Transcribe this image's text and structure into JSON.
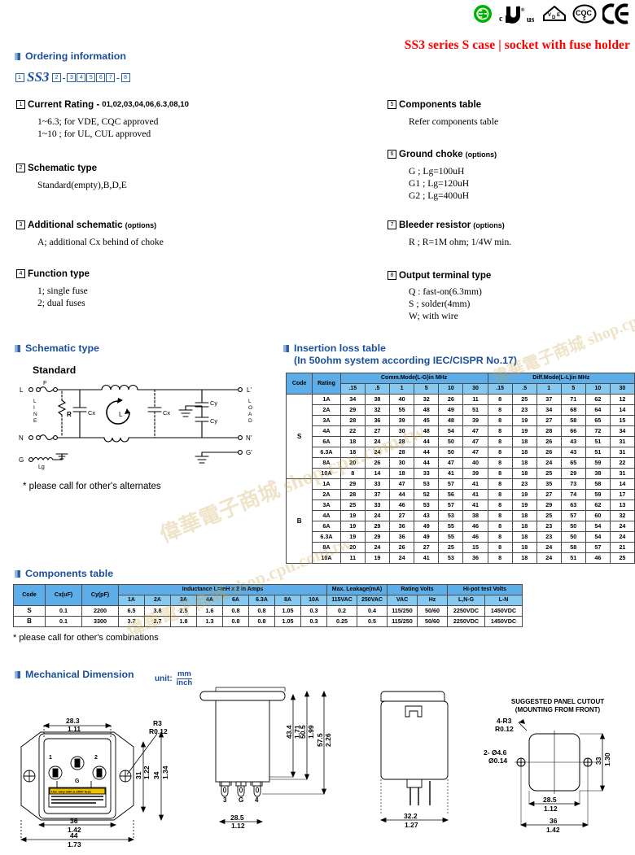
{
  "header": {
    "product_title": "SS3 series S case | socket with fuse holder",
    "certifications": [
      {
        "name": "e-mark-icon",
        "label": "E"
      },
      {
        "name": "ul-recognized-icon",
        "label": "cURus"
      },
      {
        "name": "vde-icon",
        "label": "VDE"
      },
      {
        "name": "cqc-icon",
        "label": "CQC"
      },
      {
        "name": "ce-mark-icon",
        "label": "CE"
      }
    ]
  },
  "ordering": {
    "heading": "Ordering information",
    "code_sequence": [
      "1",
      "SS3",
      "2",
      "-",
      "3",
      "4",
      "5",
      "6",
      "7",
      "-",
      "8"
    ],
    "items": [
      {
        "num": "1",
        "title": "Current Rating -",
        "tail": "01,02,03,04,06,6.3,08,10",
        "option_label": "",
        "lines": [
          "1~6.3; for VDE, CQC approved",
          "1~10 ; for UL, CUL approved"
        ]
      },
      {
        "num": "2",
        "title": "Schematic type",
        "tail": "",
        "option_label": "",
        "lines": [
          "Standard(empty),B,D,E"
        ]
      },
      {
        "num": "3",
        "title": "Additional schematic",
        "tail": "",
        "option_label": "(options)",
        "lines": [
          "A; additional Cx behind of choke"
        ]
      },
      {
        "num": "4",
        "title": "Function type",
        "tail": "",
        "option_label": "",
        "lines": [
          "1; single fuse",
          "2; dual fuses"
        ]
      },
      {
        "num": "5",
        "title": "Components table",
        "tail": "",
        "option_label": "",
        "lines": [
          "Refer components table"
        ]
      },
      {
        "num": "6",
        "title": "Ground choke",
        "tail": "",
        "option_label": "(options)",
        "lines": [
          "G ;  Lg=100uH",
          "G1 ; Lg=120uH",
          "G2 ; Lg=400uH"
        ]
      },
      {
        "num": "7",
        "title": "Bleeder resistor",
        "tail": "",
        "option_label": "(options)",
        "lines": [
          "R ; R=1M ohm; 1/4W min."
        ]
      },
      {
        "num": "8",
        "title": "Output terminal type",
        "tail": "",
        "option_label": "",
        "lines": [
          "Q : fast-on(6.3mm)",
          "S ; solder(4mm)",
          "W; with wire"
        ]
      }
    ]
  },
  "schematic": {
    "heading": "Schematic type",
    "type_label": "Standard",
    "note": "* please call for other's alternates",
    "labels": {
      "in_l": "L",
      "in_n": "N",
      "in_g": "G",
      "out_l": "L'",
      "out_n": "N'",
      "out_g": "G'",
      "line": "LINE",
      "load": "LOAD",
      "fuse": "F",
      "choke": "L",
      "ground_choke": "Lg",
      "resistor": "R",
      "cx": "Cx",
      "cy": "Cy"
    }
  },
  "insertion_loss": {
    "heading_line1": "Insertion loss table",
    "heading_line2": "(In 50ohm system according IEC/CISPR No.17)",
    "col_code": "Code",
    "col_rating": "Rating",
    "group_comm": "Comm.Mode(L-G)in MHz",
    "group_diff": "Diff.Mode(L-L)in MHz",
    "freqs": [
      ".15",
      ".5",
      "1",
      "5",
      "10",
      "30"
    ],
    "groups": [
      {
        "code": "S",
        "rows": [
          {
            "rating": "1A",
            "comm": [
              34,
              38,
              40,
              32,
              26,
              11
            ],
            "diff": [
              8,
              25,
              37,
              71,
              62,
              12
            ]
          },
          {
            "rating": "2A",
            "comm": [
              29,
              32,
              55,
              48,
              49,
              51
            ],
            "diff": [
              8,
              23,
              34,
              68,
              64,
              14
            ]
          },
          {
            "rating": "3A",
            "comm": [
              28,
              36,
              39,
              45,
              48,
              39
            ],
            "diff": [
              8,
              19,
              27,
              58,
              65,
              15
            ]
          },
          {
            "rating": "4A",
            "comm": [
              22,
              27,
              30,
              48,
              54,
              47
            ],
            "diff": [
              8,
              19,
              28,
              66,
              72,
              34
            ]
          },
          {
            "rating": "6A",
            "comm": [
              18,
              24,
              28,
              44,
              50,
              47
            ],
            "diff": [
              8,
              18,
              26,
              43,
              51,
              31
            ]
          },
          {
            "rating": "6.3A",
            "comm": [
              18,
              24,
              28,
              44,
              50,
              47
            ],
            "diff": [
              8,
              18,
              26,
              43,
              51,
              31
            ]
          },
          {
            "rating": "8A",
            "comm": [
              20,
              26,
              30,
              44,
              47,
              40
            ],
            "diff": [
              8,
              18,
              24,
              65,
              59,
              22
            ]
          },
          {
            "rating": "10A",
            "comm": [
              8,
              14,
              18,
              33,
              41,
              39
            ],
            "diff": [
              8,
              18,
              25,
              29,
              38,
              31
            ]
          }
        ]
      },
      {
        "code": "B",
        "rows": [
          {
            "rating": "1A",
            "comm": [
              29,
              33,
              47,
              53,
              57,
              41
            ],
            "diff": [
              8,
              23,
              35,
              73,
              58,
              14
            ]
          },
          {
            "rating": "2A",
            "comm": [
              28,
              37,
              44,
              52,
              56,
              41
            ],
            "diff": [
              8,
              19,
              27,
              74,
              59,
              17
            ]
          },
          {
            "rating": "3A",
            "comm": [
              25,
              33,
              46,
              53,
              57,
              41
            ],
            "diff": [
              8,
              19,
              29,
              63,
              62,
              13
            ]
          },
          {
            "rating": "4A",
            "comm": [
              19,
              24,
              27,
              43,
              53,
              38
            ],
            "diff": [
              8,
              18,
              25,
              57,
              60,
              32
            ]
          },
          {
            "rating": "6A",
            "comm": [
              19,
              29,
              36,
              49,
              55,
              46
            ],
            "diff": [
              8,
              18,
              23,
              50,
              54,
              24
            ]
          },
          {
            "rating": "6.3A",
            "comm": [
              19,
              29,
              36,
              49,
              55,
              46
            ],
            "diff": [
              8,
              18,
              23,
              50,
              54,
              24
            ]
          },
          {
            "rating": "8A",
            "comm": [
              20,
              24,
              26,
              27,
              25,
              15
            ],
            "diff": [
              8,
              18,
              24,
              58,
              57,
              21
            ]
          },
          {
            "rating": "10A",
            "comm": [
              11,
              19,
              24,
              41,
              53,
              36
            ],
            "diff": [
              8,
              18,
              24,
              51,
              46,
              25
            ]
          }
        ]
      }
    ]
  },
  "components": {
    "heading": "Components table",
    "note": "* please call for other's combinations",
    "col_code": "Code",
    "col_cx": "Cx(uF)",
    "col_cy": "Cy(pF)",
    "group_inductance": "Inductance L=mH x 2 in Amps",
    "group_leakage": "Max. Leakage(mA)",
    "group_rating": "Rating Volts",
    "group_hipot": "Hi-pot test Volts",
    "amp_cols": [
      "1A",
      "2A",
      "3A",
      "4A",
      "6A",
      "6.3A",
      "8A",
      "10A"
    ],
    "leakage_cols": [
      "115VAC",
      "250VAC"
    ],
    "rating_cols": [
      "VAC",
      "Hz"
    ],
    "hipot_cols": [
      "L,N-G",
      "L-N"
    ],
    "rows": [
      {
        "code": "S",
        "cx": "0.1",
        "cy": "2200",
        "inductance": [
          "6.5",
          "3.8",
          "2.5",
          "1.6",
          "0.8",
          "0.8",
          "1.05",
          "0.3"
        ],
        "leakage": [
          "0.2",
          "0.4"
        ],
        "rating": [
          "115/250",
          "50/60"
        ],
        "hipot": [
          "2250VDC",
          "1450VDC"
        ]
      },
      {
        "code": "B",
        "cx": "0.1",
        "cy": "3300",
        "inductance": [
          "3.7",
          "2.7",
          "1.8",
          "1.3",
          "0.8",
          "0.8",
          "1.05",
          "0.3"
        ],
        "leakage": [
          "0.25",
          "0.5"
        ],
        "rating": [
          "115/250",
          "50/60"
        ],
        "hipot": [
          "2250VDC",
          "1450VDC"
        ]
      }
    ]
  },
  "mechanical": {
    "heading": "Mechanical Dimension",
    "unit_text": "unit:",
    "unit_top": "mm",
    "unit_bottom": "inch",
    "front_view": {
      "width_mm": "28.3",
      "width_in": "1.11",
      "radius_mm": "R3",
      "radius_in": "R0.12",
      "height1_mm": "31",
      "height1_in": "1.22",
      "height2_mm": "34",
      "height2_in": "1.34",
      "body_w_mm": "36",
      "body_w_in": "1.42",
      "flange_w_mm": "44",
      "flange_w_in": "1.73",
      "pin1": "1",
      "pin2": "2",
      "ping": "G",
      "warning": "Use only with a 250V fuse"
    },
    "side_view": {
      "d1_mm": "43.4",
      "d1_in": "1.71",
      "d2_mm": "50.5",
      "d2_in": "1.99",
      "d3_mm": "57.5",
      "d3_in": "2.26",
      "w_mm": "28.5",
      "w_in": "1.12",
      "pin3": "3",
      "ping": "G",
      "pin4": "4"
    },
    "rear_view": {
      "w_mm": "32.2",
      "w_in": "1.27"
    },
    "cutout": {
      "title_line1": "SUGGESTED PANEL CUTOUT",
      "title_line2": "(MOUNTING FROM FRONT)",
      "radius_mm": "4-R3",
      "radius_in": "R0.12",
      "hole_mm": "2-  Ø4.6",
      "hole_in": "Ø0.14",
      "h_mm": "33",
      "h_in": "1.30",
      "w1_mm": "28.5",
      "w1_in": "1.12",
      "w2_mm": "36",
      "w2_in": "1.42"
    }
  },
  "colors": {
    "title_red": "#ff0000",
    "heading_blue": "#1b4f9c",
    "table_header_blue": "#5dade8",
    "table_header_blue_light": "#87c8ef"
  },
  "watermark": {
    "text": "偉華電子商城 shop.cpu.com.tw"
  }
}
